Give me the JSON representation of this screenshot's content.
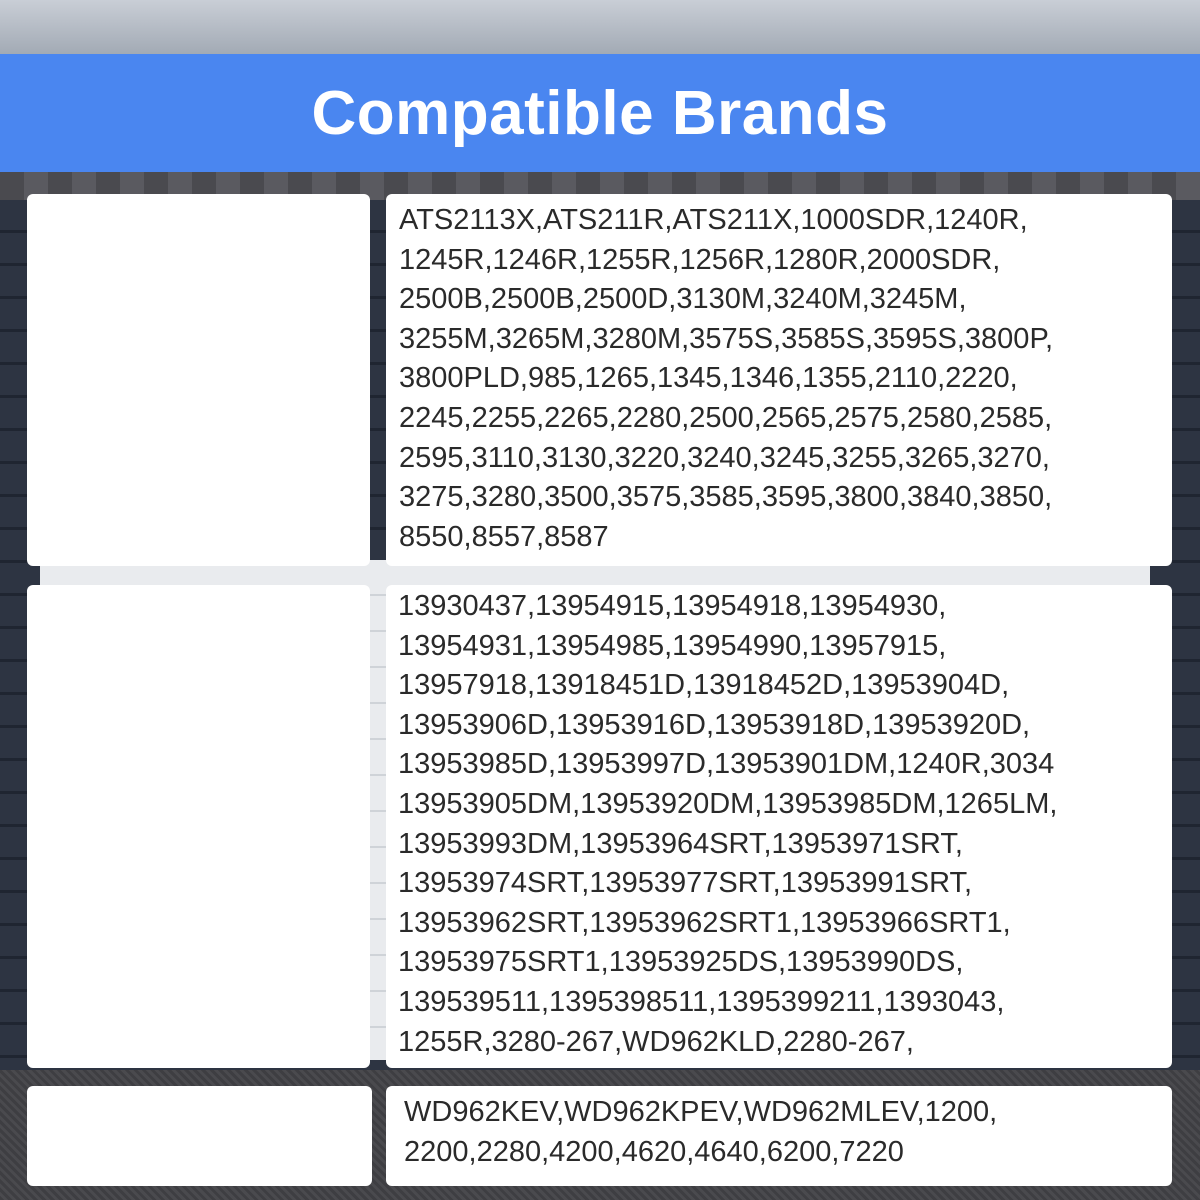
{
  "header": {
    "title": "Compatible Brands"
  },
  "brand_groups": [
    {
      "models": "ATS2113X,ATS211R,ATS211X,1000SDR,1240R,\n1245R,1246R,1255R,1256R,1280R,2000SDR,\n2500B,2500B,2500D,3130M,3240M,3245M,\n3255M,3265M,3280M,3575S,3585S,3595S,3800P,\n3800PLD,985,1265,1345,1346,1355,2110,2220,\n2245,2255,2265,2280,2500,2565,2575,2580,2585,\n2595,3110,3130,3220,3240,3245,3255,3265,3270,\n3275,3280,3500,3575,3585,3595,3800,3840,3850,\n8550,8557,8587"
    },
    {
      "models": "13930437,13954915,13954918,13954930,\n13954931,13954985,13954990,13957915,\n13957918,13918451D,13918452D,13953904D,\n13953906D,13953916D,13953918D,13953920D,\n13953985D,13953997D,13953901DM,1240R,3034\n13953905DM,13953920DM,13953985DM,1265LM,\n13953993DM,13953964SRT,13953971SRT,\n13953974SRT,13953977SRT,13953991SRT,\n13953962SRT,13953962SRT1,13953966SRT1,\n13953975SRT1,13953925DS,13953990DS,\n139539511,1395398511,1395399211,1393043,\n1255R,3280-267,WD962KLD,2280-267,"
    },
    {
      "models": "WD962KEV,WD962KPEV,WD962MLEV,1200,\n2200,2280,4200,4620,4640,6200,7220"
    }
  ],
  "colors": {
    "banner": "#4a86f0",
    "panel": "#ffffff",
    "text": "#2a2a2a"
  }
}
